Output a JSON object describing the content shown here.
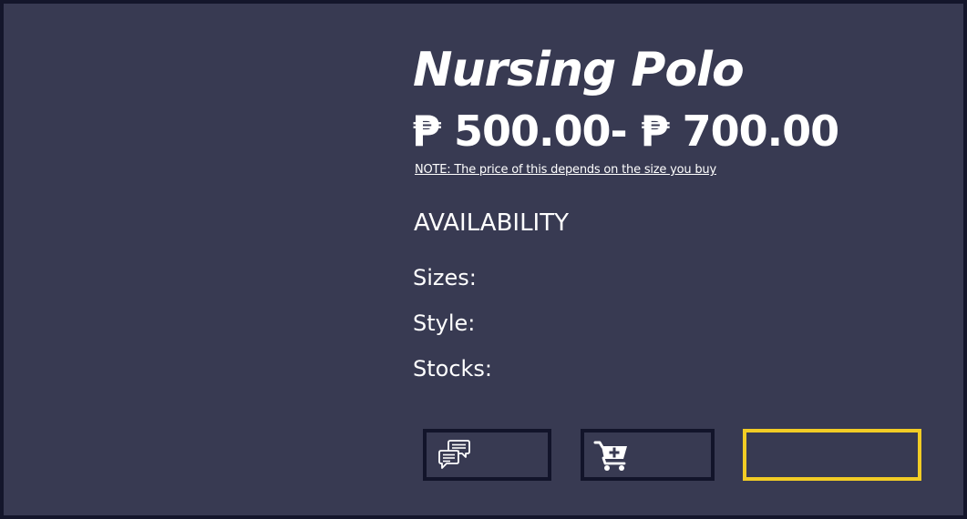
{
  "product": {
    "name": "Nursing Polo",
    "price_range": "₱ 500.00- ₱ 700.00",
    "note": "NOTE: The price of this depends on the size you buy"
  },
  "availability": {
    "heading": "AVAILABILITY",
    "sizes_label": "Sizes:",
    "style_label": "Style:",
    "stocks_label": "Stocks:"
  },
  "actions": {
    "chat_icon": "chat-bubbles-icon",
    "cart_icon": "add-to-cart-icon"
  },
  "colors": {
    "background": "#383a52",
    "frame": "#14162b",
    "button_border": "#12142a",
    "highlight_border": "#f2cc25",
    "text": "#ffffff"
  }
}
